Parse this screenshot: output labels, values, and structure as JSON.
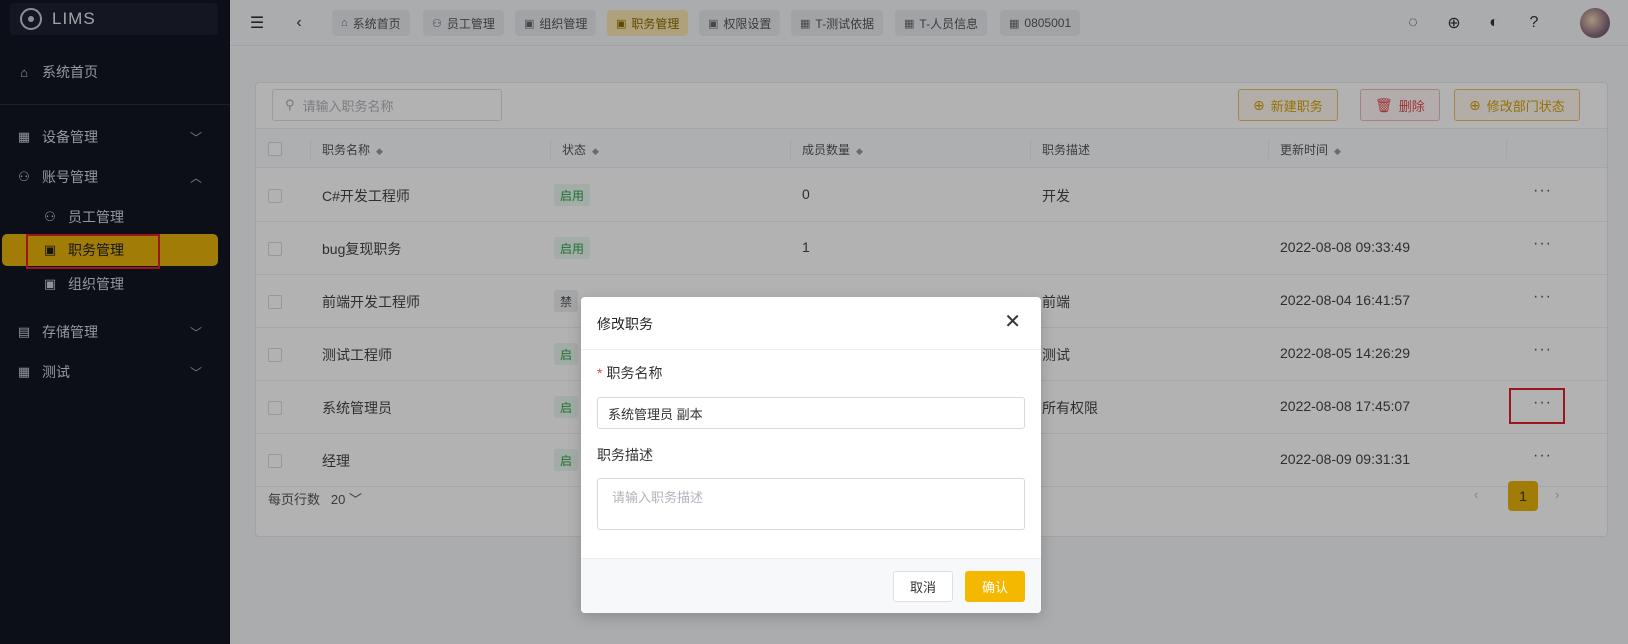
{
  "app": {
    "name": "LIMS"
  },
  "sidebar": {
    "home": "系统首页",
    "groups": [
      {
        "label": "设备管理",
        "expanded": false
      },
      {
        "label": "账号管理",
        "expanded": true
      },
      {
        "label": "存储管理",
        "expanded": false
      },
      {
        "label": "测试",
        "expanded": false
      }
    ],
    "sub_items": [
      "员工管理",
      "职务管理",
      "组织管理"
    ],
    "active": "职务管理"
  },
  "tabs": [
    {
      "label": "系统首页",
      "icon": "home-icon"
    },
    {
      "label": "员工管理",
      "icon": "users-icon"
    },
    {
      "label": "组织管理",
      "icon": "user-box-icon"
    },
    {
      "label": "职务管理",
      "icon": "user-box-icon",
      "active": true
    },
    {
      "label": "权限设置",
      "icon": "user-box-icon"
    },
    {
      "label": "T-测试依据",
      "icon": "grid-icon"
    },
    {
      "label": "T-人员信息",
      "icon": "grid-icon"
    },
    {
      "label": "0805001",
      "icon": "grid-icon"
    }
  ],
  "toolbar": {
    "search_placeholder": "请输入职务名称",
    "new_label": "新建职务",
    "delete_label": "删除",
    "dept_status_label": "修改部门状态"
  },
  "table": {
    "headers": {
      "name": "职务名称",
      "status": "状态",
      "members": "成员数量",
      "desc": "职务描述",
      "updated": "更新时间"
    },
    "rows": [
      {
        "name": "C#开发工程师",
        "status": "启用",
        "members": "0",
        "desc": "开发",
        "updated": ""
      },
      {
        "name": "bug复现职务",
        "status": "启用",
        "members": "1",
        "desc": "",
        "updated": "2022-08-08 09:33:49"
      },
      {
        "name": "前端开发工程师",
        "status": "禁",
        "members": "",
        "desc": "前端",
        "updated": "2022-08-04 16:41:57"
      },
      {
        "name": "测试工程师",
        "status": "启",
        "members": "",
        "desc": "测试",
        "updated": "2022-08-05 14:26:29"
      },
      {
        "name": "系统管理员",
        "status": "启",
        "members": "",
        "desc": "所有权限",
        "updated": "2022-08-08 17:45:07"
      },
      {
        "name": "经理",
        "status": "启",
        "members": "",
        "desc": "",
        "updated": "2022-08-09 09:31:31"
      }
    ],
    "more_label": "···"
  },
  "pagination": {
    "rows_label": "每页行数",
    "rows_value": "20",
    "current": "1"
  },
  "modal": {
    "title": "修改职务",
    "name_label": "职务名称",
    "name_value": "系统管理员 副本",
    "desc_label": "职务描述",
    "desc_placeholder": "请输入职务描述",
    "cancel": "取消",
    "ok": "确认"
  },
  "colors": {
    "accent": "#e7b20a",
    "sidebar": "#121622",
    "danger": "#e5484d",
    "success": "#2aa34a"
  }
}
